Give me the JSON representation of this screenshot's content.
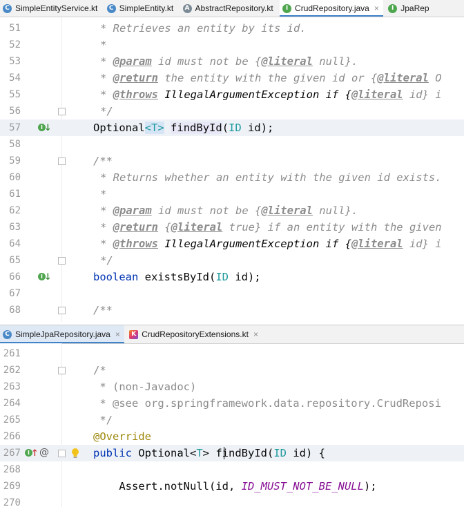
{
  "colors": {
    "accent": "#4083c9",
    "keyword": "#0033b3",
    "type_param": "#20999d",
    "annotation": "#9e880d",
    "constant": "#871094",
    "comment": "#8c8c8c",
    "implemented_icon": "#4ea64e",
    "overrides_arrow": "#c93c3c"
  },
  "top_tabs": [
    {
      "label": "SimpleEntityService.kt",
      "icon": "class-icon",
      "icon_glyph": "C"
    },
    {
      "label": "SimpleEntity.kt",
      "icon": "class-icon",
      "icon_glyph": "C"
    },
    {
      "label": "AbstractRepository.kt",
      "icon": "abstract-class-icon",
      "icon_glyph": "A"
    },
    {
      "label": "CrudRepository.java",
      "icon": "interface-icon",
      "icon_glyph": "I",
      "active": true,
      "close": "×"
    },
    {
      "label": "JpaRep",
      "icon": "interface-icon",
      "icon_glyph": "I"
    }
  ],
  "bottom_tabs": [
    {
      "label": "SimpleJpaRepository.java",
      "icon": "class-icon",
      "icon_glyph": "C",
      "active": true,
      "close": "×"
    },
    {
      "label": "CrudRepositoryExtensions.kt",
      "icon": "kotlin-file-icon",
      "icon_glyph": "K",
      "close": "×"
    }
  ],
  "top_editor": {
    "line_numbers": [
      "51",
      "52",
      "53",
      "54",
      "55",
      "56",
      "57",
      "58",
      "59",
      "60",
      "61",
      "62",
      "63",
      "64",
      "65",
      "66",
      "67",
      "68"
    ],
    "text": {
      "l51": "* Retrieves an entity by its id.",
      "l52": "*",
      "l53": {
        "a": "* ",
        "tag": "@param",
        "b": " id must not be {",
        "lit": "@literal",
        "c": " null}."
      },
      "l54": {
        "a": "* ",
        "tag": "@return",
        "b": " the entity with the given id or {",
        "lit": "@literal",
        "c": " O"
      },
      "l55": {
        "a": "* ",
        "tag": "@throws",
        "b": " IllegalArgumentException if {",
        "lit": "@literal",
        "c": " id} i"
      },
      "l56": "*/",
      "l57": {
        "a": "Optional",
        "lt": "<",
        "t": "T",
        "gt": ">",
        "b": " ",
        "m": "findById",
        "c": "(",
        "t2": "ID",
        "d": " id);"
      },
      "l59": "/**",
      "l60": "* Returns whether an entity with the given id exists.",
      "l61": "*",
      "l62": {
        "a": "* ",
        "tag": "@param",
        "b": " id must not be {",
        "lit": "@literal",
        "c": " null}."
      },
      "l63": {
        "a": "* ",
        "tag": "@return",
        "b": " {",
        "lit": "@literal",
        "c": " true} if an entity with the given"
      },
      "l64": {
        "a": "* ",
        "tag": "@throws",
        "b": " IllegalArgumentException if {",
        "lit": "@literal",
        "c": " id} i"
      },
      "l65": "*/",
      "l66": {
        "kw": "boolean",
        "b": " existsById(",
        "t": "ID",
        "c": " id);"
      },
      "l68": "/**"
    }
  },
  "bottom_editor": {
    "line_numbers": [
      "261",
      "262",
      "263",
      "264",
      "265",
      "266",
      "267",
      "268",
      "269",
      "270"
    ],
    "text": {
      "l262": "/*",
      "l263": " * (non-Javadoc)",
      "l264": " * @see org.springframework.data.repository.CrudReposi",
      "l265": " */",
      "l266": "@Override",
      "l267": {
        "kw": "public",
        "b": " Optional<",
        "t": "T",
        "c": "> ",
        "m": "findById",
        "d": "(",
        "t2": "ID",
        "e": " id) {"
      },
      "l269": {
        "a": "    Assert.notNull(id, ",
        "const": "ID_MUST_NOT_BE_NULL",
        "b": ");"
      }
    },
    "gutter_at": "@"
  }
}
